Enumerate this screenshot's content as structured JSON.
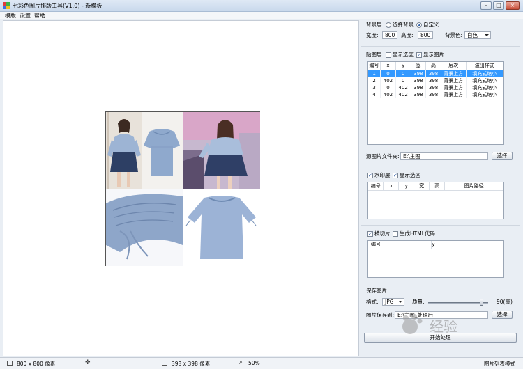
{
  "window": {
    "title": "七彩色图片排版工具(V1.0) - 新模板",
    "minimize": "–",
    "maximize": "□",
    "close": "×"
  },
  "menu": [
    "模版",
    "设置",
    "帮助"
  ],
  "background": {
    "label": "背景层:",
    "option_select": "选择背景",
    "option_custom": "自定义",
    "selected": "自定义",
    "width_label": "宽度:",
    "width_value": "800",
    "height_label": "高度:",
    "height_value": "800",
    "color_label": "背景色:",
    "color_value": "白色"
  },
  "paste_layer": {
    "label": "贴图层:",
    "show_selection": "显示选区",
    "show_selection_checked": false,
    "show_image": "显示图片",
    "show_image_checked": true,
    "columns": [
      "编号",
      "x",
      "y",
      "宽",
      "高",
      "层次",
      "溢出样式"
    ],
    "rows": [
      [
        "1",
        "0",
        "0",
        "398",
        "398",
        "背景上方",
        "填充式缩小"
      ],
      [
        "2",
        "402",
        "0",
        "398",
        "398",
        "背景上方",
        "填充式缩小"
      ],
      [
        "3",
        "0",
        "402",
        "398",
        "398",
        "背景上方",
        "填充式缩小"
      ],
      [
        "4",
        "402",
        "402",
        "398",
        "398",
        "背景上方",
        "填充式缩小"
      ]
    ],
    "selected_row": 0
  },
  "source": {
    "label": "源图片文件夹:",
    "value": "E:\\主图",
    "button": "选择"
  },
  "watermark_layer": {
    "label": "水印层",
    "checked": true,
    "show_selection": "显示选区",
    "show_selection_checked": true,
    "columns": [
      "编号",
      "x",
      "y",
      "宽",
      "高",
      "图片路径"
    ]
  },
  "slicing": {
    "label": "横切片",
    "checked": true,
    "html_label": "生成HTML代码",
    "html_checked": false,
    "columns": [
      "编号",
      "y"
    ]
  },
  "save": {
    "title": "保存图片",
    "format_label": "格式:",
    "format_value": "JPG",
    "quality_label": "质量:",
    "quality_value": 90,
    "quality_text": "90(高)",
    "path_label": "图片保存到:",
    "path_value": "E:\\主图_处理后",
    "path_button": "选择",
    "start_button": "开始处理"
  },
  "status": {
    "canvas_size": "800 x 800 像素",
    "cell_size": "398 x 398 像素",
    "zoom": "50%",
    "mode": "图片列表模式"
  },
  "watermark_text": "经验",
  "colors": {
    "selection": "#3399ff",
    "titlebar": "#dfe9f5",
    "blouse": "#8fa9cd",
    "skirt": "#2d3f64"
  }
}
